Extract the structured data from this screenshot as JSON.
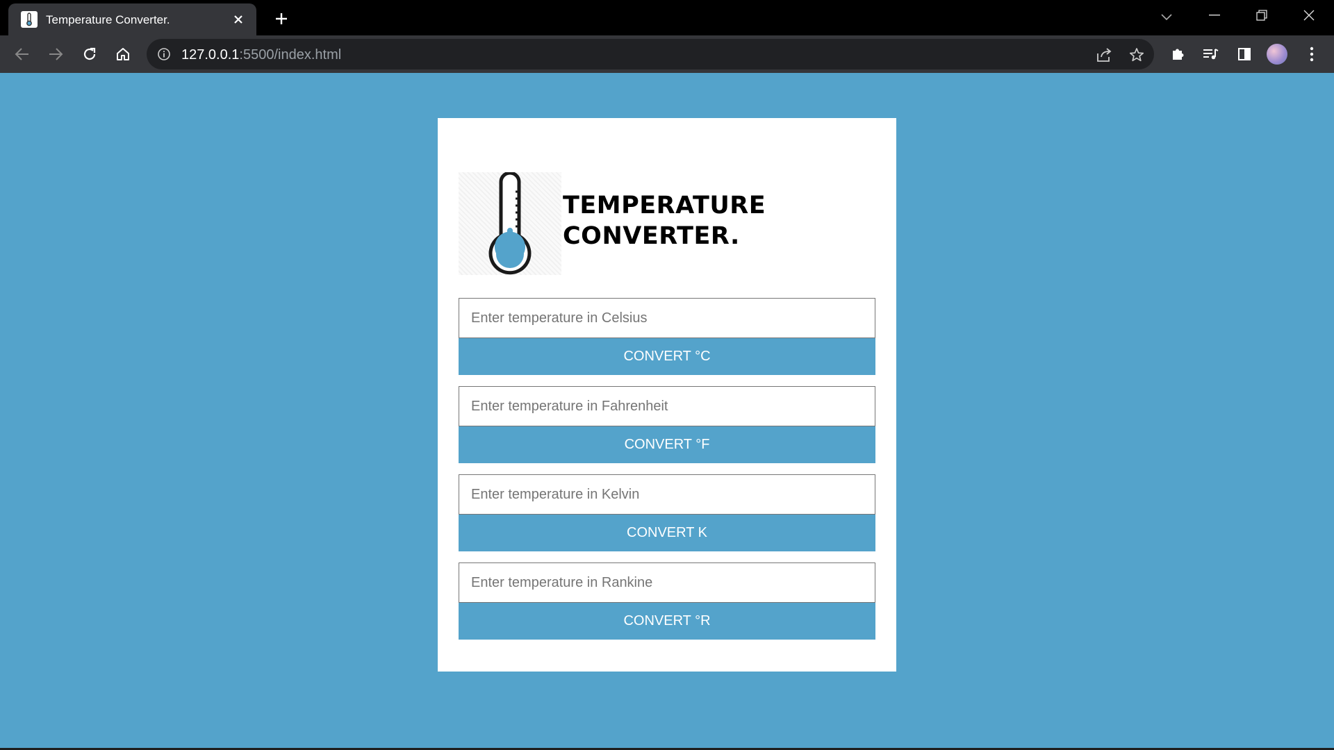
{
  "browser": {
    "tab_title": "Temperature Converter.",
    "url_host": "127.0.0.1",
    "url_path": ":5500/index.html"
  },
  "icons": {
    "favicon": "thermometer-icon",
    "tab_close": "close-icon",
    "new_tab": "plus-icon",
    "tab_search": "chevron-down-icon",
    "back": "arrow-left-icon",
    "forward": "arrow-right-icon",
    "reload": "reload-icon",
    "home": "home-icon",
    "site_info": "info-icon",
    "share": "share-icon",
    "bookmark": "star-icon",
    "extensions": "puzzle-icon",
    "media": "media-queue-icon",
    "side_panel": "side-panel-icon",
    "menu": "kebab-menu-icon",
    "logo": "thermometer-icon"
  },
  "page": {
    "title_line1": "TEMPERATURE",
    "title_line2": "CONVERTER.",
    "converters": [
      {
        "placeholder": "Enter temperature in Celsius",
        "button": "CONVERT °C"
      },
      {
        "placeholder": "Enter temperature in Fahrenheit",
        "button": "CONVERT °F"
      },
      {
        "placeholder": "Enter temperature in Kelvin",
        "button": "CONVERT K"
      },
      {
        "placeholder": "Enter temperature in Rankine",
        "button": "CONVERT °R"
      }
    ]
  },
  "colors": {
    "page_background": "#54a3cb",
    "button_background": "#54a3cb",
    "card_background": "#ffffff",
    "thermometer_fill": "#54a3cb"
  }
}
